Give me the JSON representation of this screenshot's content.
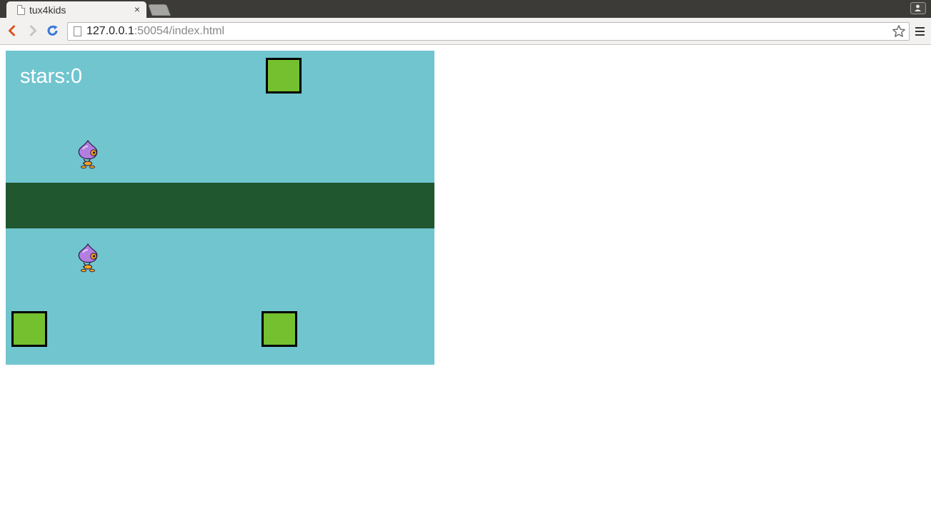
{
  "browser": {
    "tab_title": "tux4kids",
    "tab_close": "×",
    "url_host": "127.0.0.1",
    "url_rest": ":50054/index.html"
  },
  "game": {
    "stars_label": "stars:0",
    "colors": {
      "sky": "#71c5cf",
      "ground": "#20572f",
      "block": "#75c02f",
      "text": "#ffffff"
    },
    "icons": {
      "player": "purple-onion-creature-icon",
      "block": "green-square-block"
    }
  }
}
